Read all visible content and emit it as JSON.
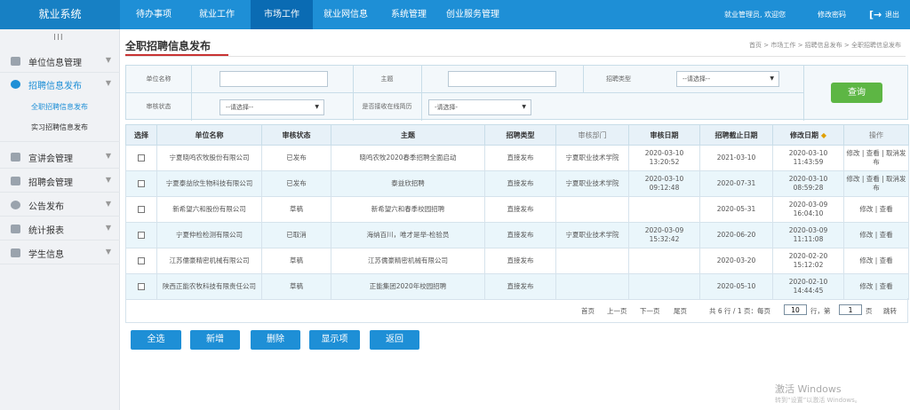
{
  "app": {
    "title": "就业系统"
  },
  "nav": [
    {
      "label": "待办事项"
    },
    {
      "label": "就业工作"
    },
    {
      "label": "市场工作"
    },
    {
      "label": "就业网信息"
    },
    {
      "label": "系统管理"
    },
    {
      "label": "创业服务管理"
    }
  ],
  "user": {
    "welcome": "就业管理员, 欢迎您",
    "change_password": "修改密码",
    "logout_icon": "logout-arrow",
    "logout": "退出"
  },
  "sidebar": {
    "grip": "III",
    "items": [
      {
        "label": "单位信息管理",
        "icon": "building-icon"
      },
      {
        "label": "招聘信息发布",
        "icon": "eye-icon"
      },
      {
        "label": "宣讲会管理",
        "icon": "presenter-icon"
      },
      {
        "label": "招聘会管理",
        "icon": "calendar-icon"
      },
      {
        "label": "公告发布",
        "icon": "globe-icon"
      },
      {
        "label": "统计报表",
        "icon": "folder-icon"
      },
      {
        "label": "学生信息",
        "icon": "document-icon"
      }
    ],
    "sub": [
      {
        "label": "全职招聘信息发布"
      },
      {
        "label": "实习招聘信息发布"
      }
    ]
  },
  "page": {
    "title": "全职招聘信息发布",
    "breadcrumb": "首页 > 市场工作 > 招聘信息发布 > 全职招聘信息发布"
  },
  "filter": {
    "company_label": "单位名称",
    "company_value": "",
    "subject_label": "主题",
    "subject_value": "",
    "type_label": "招聘类型",
    "type_value": "--请选择--",
    "status_label": "审核状态",
    "status_value": "--请选择--",
    "online_label": "是否接收在线简历",
    "online_value": "-请选择-",
    "search": "查询"
  },
  "table": {
    "headers": [
      "选择",
      "单位名称",
      "审核状态",
      "主题",
      "招聘类型",
      "审核部门",
      "审核日期",
      "招聘截止日期",
      "修改日期",
      "操作"
    ],
    "sort_icon": "sort-icon",
    "rows": [
      {
        "company": "宁夏晓鸣农牧股份有限公司",
        "status": "已发布",
        "subject": "晓鸣农牧2020春季招聘全面启动",
        "type": "直接发布",
        "dept": "宁夏职业技术学院",
        "audit_date": "2020-03-10 13:20:52",
        "deadline": "2021-03-10",
        "modified": "2020-03-10 11:43:59",
        "ops": "修改 | 查看 | 取消发布"
      },
      {
        "company": "宁夏泰益欣生物科技有限公司",
        "status": "已发布",
        "subject": "泰益欣招聘",
        "type": "直接发布",
        "dept": "宁夏职业技术学院",
        "audit_date": "2020-03-10 09:12:48",
        "deadline": "2020-07-31",
        "modified": "2020-03-10 08:59:28",
        "ops": "修改 | 查看 | 取消发布"
      },
      {
        "company": "新希望六和股份有限公司",
        "status": "草稿",
        "subject": "新希望六和春季校园招聘",
        "type": "直接发布",
        "dept": "",
        "audit_date": "",
        "deadline": "2020-05-31",
        "modified": "2020-03-09 16:04:10",
        "ops": "修改 | 查看"
      },
      {
        "company": "宁夏仲检检测有限公司",
        "status": "已取消",
        "subject": "海纳百川，唯才是举-检验员",
        "type": "直接发布",
        "dept": "宁夏职业技术学院",
        "audit_date": "2020-03-09 15:32:42",
        "deadline": "2020-06-20",
        "modified": "2020-03-09 11:11:08",
        "ops": "修改 | 查看"
      },
      {
        "company": "江苏儒豪精密机械有限公司",
        "status": "草稿",
        "subject": "江苏儒豪精密机械有限公司",
        "type": "直接发布",
        "dept": "",
        "audit_date": "",
        "deadline": "2020-03-20",
        "modified": "2020-02-20 15:12:02",
        "ops": "修改 | 查看"
      },
      {
        "company": "陕西正能农牧科技有限责任公司",
        "status": "草稿",
        "subject": "正能集团2020年校园招聘",
        "type": "直接发布",
        "dept": "",
        "audit_date": "",
        "deadline": "2020-05-10",
        "modified": "2020-02-10 14:44:45",
        "ops": "修改 | 查看"
      }
    ]
  },
  "pager": {
    "first": "首页",
    "prev": "上一页",
    "next": "下一页",
    "last": "尾页",
    "summary": "共 6 行 / 1 页：每页",
    "per_page": "10",
    "rows_unit": "行，第",
    "page": "1",
    "page_unit": "页",
    "jump": "跳转"
  },
  "actions": {
    "select_all": "全选",
    "add": "新增",
    "delete": "删除",
    "display": "显示项",
    "back": "返回"
  },
  "watermark": {
    "line1": "激活 Windows",
    "line2": "转到“设置”以激活 Windows。"
  }
}
